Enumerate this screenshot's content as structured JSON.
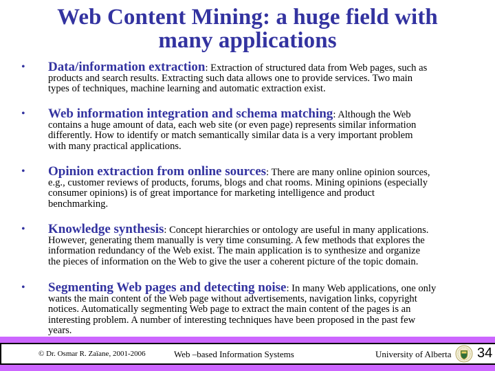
{
  "slide": {
    "title_line1": "Web Content Mining: a huge field with",
    "title_line2": "many applications",
    "title_color": "#3333a0",
    "bullets": [
      {
        "heading": "Data/information extraction",
        "lead": ": Extraction of structured data from Web pages, such as",
        "lines": [
          "products and search results. Extracting such data allows one to provide services. Two main",
          "types of techniques, machine learning and automatic extraction exist."
        ]
      },
      {
        "heading": "Web information integration and schema matching",
        "lead": ": Although the Web",
        "lines": [
          "contains a huge amount of data, each web site (or even page) represents similar information",
          "differently. How to identify or match semantically similar data is a very important problem",
          "with many practical applications."
        ]
      },
      {
        "heading": "Opinion extraction from online sources",
        "lead": ": There are many online opinion sources,",
        "lines": [
          "e.g., customer reviews of products, forums, blogs and chat rooms. Mining opinions (especially",
          "consumer opinions) is of great importance for marketing intelligence and product",
          "benchmarking."
        ]
      },
      {
        "heading": "Knowledge synthesis",
        "lead": ": Concept hierarchies or ontology are useful in many applications.",
        "lines": [
          "However, generating them manually is very time consuming. A few methods that explores the",
          "information redundancy of the Web exist. The main application is to synthesize and organize",
          "the pieces of information on the Web to give the user a coherent picture of the topic domain."
        ]
      },
      {
        "heading": "Segmenting Web pages and detecting noise",
        "lead": ": In many Web applications, one only",
        "lines": [
          "wants the main content of the Web page without advertisements, navigation links, copyright",
          "notices. Automatically segmenting Web page to extract the main content of the pages is an",
          "interesting problem. A number of interesting techniques have been proposed in the past few",
          "years."
        ]
      }
    ]
  },
  "footer": {
    "copyright": "© Dr. Osmar R. Zaïane, 2001-2006",
    "course": "Web –based Information Systems",
    "university": "University  of Alberta",
    "crest_icon": "university-crest-icon",
    "page_number": "34",
    "bar_color": "#cc66ff"
  }
}
